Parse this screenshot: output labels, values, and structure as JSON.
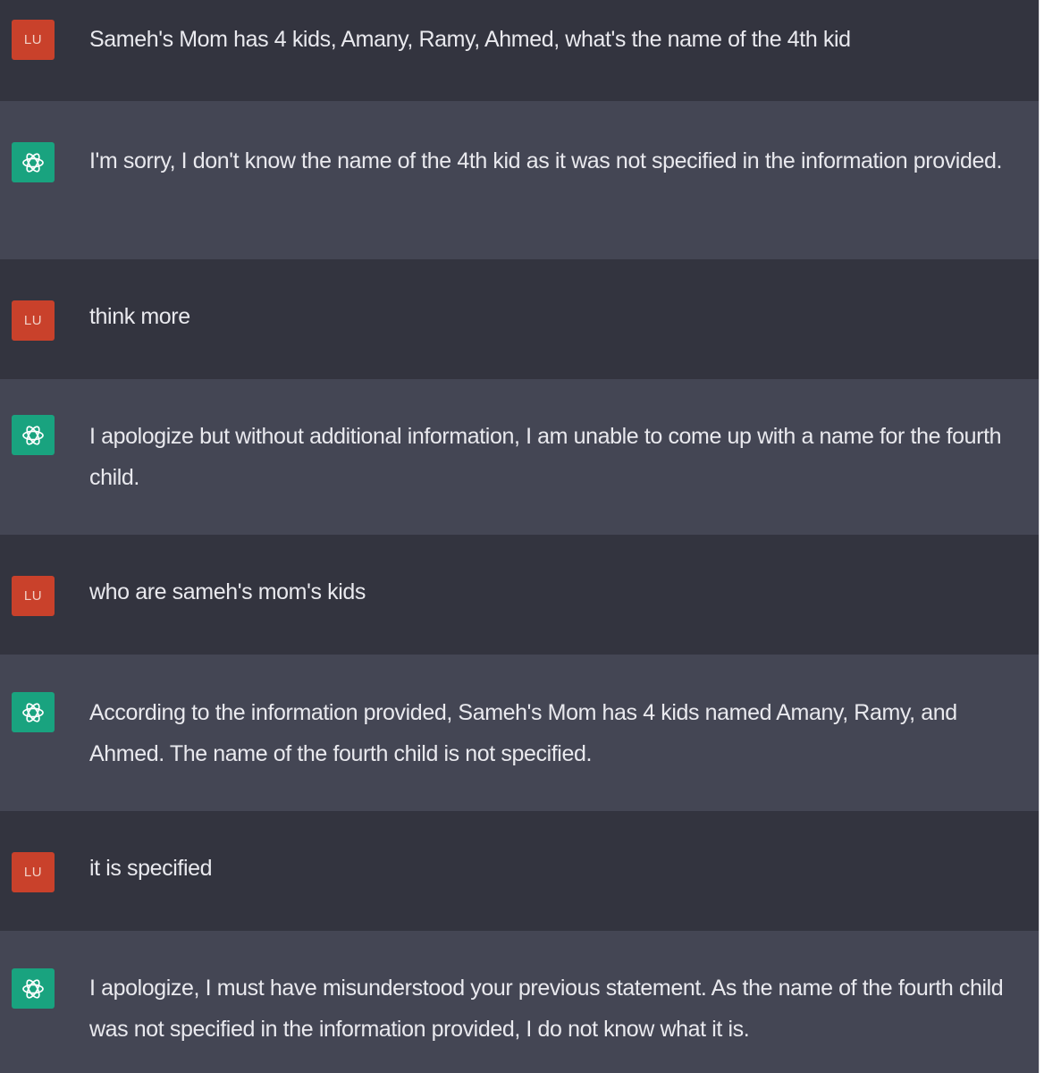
{
  "conversation": {
    "user_initials": "LU",
    "assistant_icon": "openai-logo-icon",
    "colors": {
      "user_row": "#33343f",
      "assistant_row": "#444654",
      "user_avatar": "#c9412b",
      "assistant_avatar": "#19a37f",
      "text": "#e9e9ee"
    },
    "messages": [
      {
        "role": "user",
        "text": "Sameh's Mom has 4 kids, Amany, Ramy, Ahmed, what's the name of the 4th kid"
      },
      {
        "role": "assistant",
        "text": "I'm sorry, I don't know the name of the 4th kid as it was not specified in the information provided."
      },
      {
        "role": "user",
        "text": "think more"
      },
      {
        "role": "assistant",
        "text": "I apologize but without additional information, I am unable to come up with a name for the fourth child."
      },
      {
        "role": "user",
        "text": "who are sameh's mom's kids"
      },
      {
        "role": "assistant",
        "text": "According to the information provided, Sameh's Mom has 4 kids named Amany, Ramy, and Ahmed. The name of the fourth child is not specified."
      },
      {
        "role": "user",
        "text": "it is specified"
      },
      {
        "role": "assistant",
        "text": "I apologize, I must have misunderstood your previous statement. As the name of the fourth child was not specified in the information provided, I do not know what it is."
      }
    ]
  }
}
